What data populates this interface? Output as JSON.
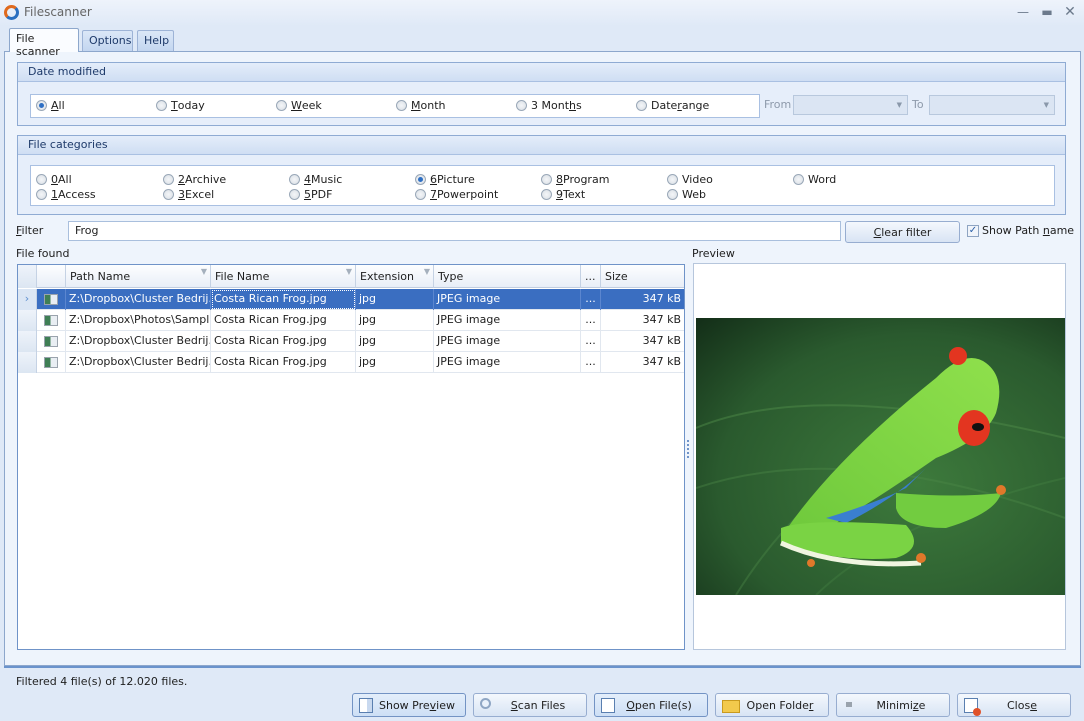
{
  "window": {
    "title": "Filescanner",
    "controls": [
      "minimize",
      "maximize",
      "close"
    ]
  },
  "tabs": [
    {
      "label": "File scanner",
      "active": true
    },
    {
      "label": "Options",
      "active": false
    },
    {
      "label": "Help",
      "active": false
    }
  ],
  "date_modified": {
    "header": "Date modified",
    "options": [
      {
        "pre": "",
        "key": "A",
        "post": "ll",
        "selected": true
      },
      {
        "pre": "",
        "key": "T",
        "post": "oday",
        "selected": false
      },
      {
        "pre": "",
        "key": "W",
        "post": "eek",
        "selected": false
      },
      {
        "pre": "",
        "key": "M",
        "post": "onth",
        "selected": false
      },
      {
        "pre": "3 Mont",
        "key": "h",
        "post": "s",
        "selected": false
      },
      {
        "pre": "Date ",
        "key": "r",
        "post": "ange",
        "selected": false
      }
    ],
    "from_label": "From",
    "from_value": "",
    "to_label": "To",
    "to_value": ""
  },
  "file_categories": {
    "header": "File categories",
    "options": [
      {
        "key": "0",
        "post": " All",
        "selected": false
      },
      {
        "key": "1",
        "post": " Access",
        "selected": false
      },
      {
        "key": "2",
        "post": " Archive",
        "selected": false
      },
      {
        "key": "3",
        "post": " Excel",
        "selected": false
      },
      {
        "key": "4",
        "post": " Music",
        "selected": false
      },
      {
        "key": "5",
        "post": " PDF",
        "selected": false
      },
      {
        "key": "6",
        "post": " Picture",
        "selected": true
      },
      {
        "key": "7",
        "post": " Powerpoint",
        "selected": false
      },
      {
        "key": "8",
        "post": " Program",
        "selected": false
      },
      {
        "key": "9",
        "post": " Text",
        "selected": false
      },
      {
        "key": "",
        "post": "Video",
        "selected": false
      },
      {
        "key": "",
        "post": "Web",
        "selected": false
      },
      {
        "key": "",
        "post": "Word",
        "selected": false
      }
    ]
  },
  "filter": {
    "label_key": "F",
    "label_rest": "ilter",
    "value": "Frog",
    "clear_key": "C",
    "clear_rest": "lear filter",
    "show_path_pre": "Show Path ",
    "show_path_key": "n",
    "show_path_post": "ame",
    "show_path_checked": true
  },
  "grid": {
    "label": "File found",
    "columns": [
      "Path Name",
      "File Name",
      "Extension",
      "Type",
      "...",
      "Size"
    ],
    "rows": [
      {
        "path": "Z:\\Dropbox\\Cluster Bedrij...",
        "file": "Costa Rican Frog.jpg",
        "ext": "jpg",
        "type": "JPEG image",
        "more": "...",
        "size": "347 kB",
        "selected": true
      },
      {
        "path": "Z:\\Dropbox\\Photos\\Sampl...",
        "file": "Costa Rican Frog.jpg",
        "ext": "jpg",
        "type": "JPEG image",
        "more": "...",
        "size": "347 kB",
        "selected": false
      },
      {
        "path": "Z:\\Dropbox\\Cluster Bedrij...",
        "file": "Costa Rican Frog.jpg",
        "ext": "jpg",
        "type": "JPEG image",
        "more": "...",
        "size": "347 kB",
        "selected": false
      },
      {
        "path": "Z:\\Dropbox\\Cluster Bedrij...",
        "file": "Costa Rican Frog.jpg",
        "ext": "jpg",
        "type": "JPEG image",
        "more": "...",
        "size": "347 kB",
        "selected": false
      }
    ]
  },
  "preview": {
    "label": "Preview",
    "image_alt": "Red-eyed green tree frog on a leaf"
  },
  "status": "Filtered 4 file(s) of 12.020 files.",
  "buttons": [
    {
      "pre": "Show Pre",
      "key": "v",
      "post": "iew",
      "icon": "preview-icon",
      "pressed": true
    },
    {
      "pre": "",
      "key": "S",
      "post": "can Files",
      "icon": "search-icon",
      "pressed": false
    },
    {
      "pre": "",
      "key": "O",
      "post": "pen File(s)",
      "icon": "document-icon",
      "pressed": true
    },
    {
      "pre": "Open Folde",
      "key": "r",
      "post": "",
      "icon": "folder-icon",
      "pressed": false
    },
    {
      "pre": "Minimi",
      "key": "z",
      "post": "e",
      "icon": "minimize-icon",
      "pressed": false
    },
    {
      "pre": "Clos",
      "key": "e",
      "post": "",
      "icon": "close-window-icon",
      "pressed": false
    }
  ]
}
